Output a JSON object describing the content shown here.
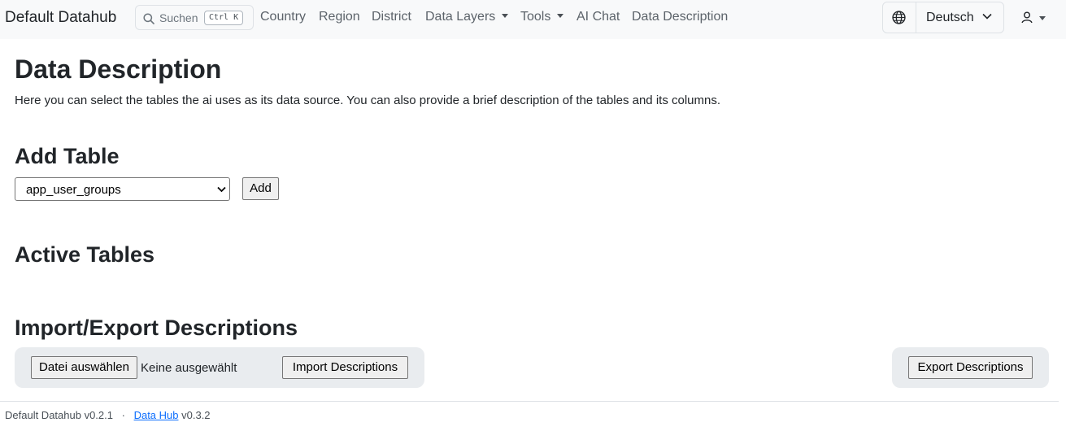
{
  "navbar": {
    "brand": "Default Datahub",
    "search_label": "Suchen",
    "search_shortcut": "Ctrl K",
    "links": [
      "Country",
      "Region",
      "District",
      "Data Layers",
      "Tools",
      "AI Chat",
      "Data Description"
    ],
    "language": "Deutsch"
  },
  "page": {
    "title": "Data Description",
    "intro": "Here you can select the tables the ai uses as its data source. You can also provide a brief description of the tables and its columns.",
    "add_table_heading": "Add Table",
    "selected_table": "app_user_groups",
    "add_button": "Add",
    "active_tables_heading": "Active Tables",
    "import_export_heading": "Import/Export Descriptions",
    "choose_file_button": "Datei auswählen",
    "no_file_text": "Keine ausgewählt",
    "import_button": "Import Descriptions",
    "export_button": "Export Descriptions"
  },
  "footer": {
    "app_version": "Default Datahub v0.2.1",
    "separator": "·",
    "link_text": "Data Hub",
    "hub_version": "v0.3.2"
  }
}
